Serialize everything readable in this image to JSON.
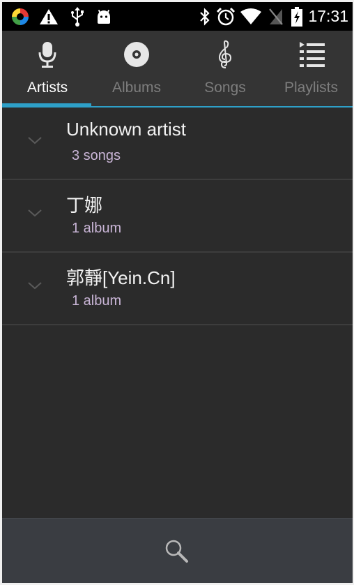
{
  "status_bar": {
    "time": "17:31",
    "icons": [
      "app-color-icon",
      "warning-icon",
      "usb-icon",
      "android-icon",
      "bluetooth-icon",
      "alarm-icon",
      "wifi-icon",
      "no-sim-icon",
      "battery-charging-icon"
    ]
  },
  "tabs": [
    {
      "label": "Artists",
      "icon": "microphone-icon",
      "active": true
    },
    {
      "label": "Albums",
      "icon": "disc-icon",
      "active": false
    },
    {
      "label": "Songs",
      "icon": "treble-clef-icon",
      "active": false
    },
    {
      "label": "Playlists",
      "icon": "playlist-icon",
      "active": false
    }
  ],
  "artists": [
    {
      "name": "Unknown artist",
      "detail": "3 songs"
    },
    {
      "name": "丁娜",
      "detail": "1 album"
    },
    {
      "name": "郭靜[Yein.Cn]",
      "detail": "1 album"
    }
  ],
  "bottom_bar": {
    "icon": "search-icon"
  },
  "colors": {
    "accent": "#2ea0c8",
    "background": "#2b2b2b",
    "tabbar": "#343434",
    "subtitle": "#c9b5d6"
  }
}
